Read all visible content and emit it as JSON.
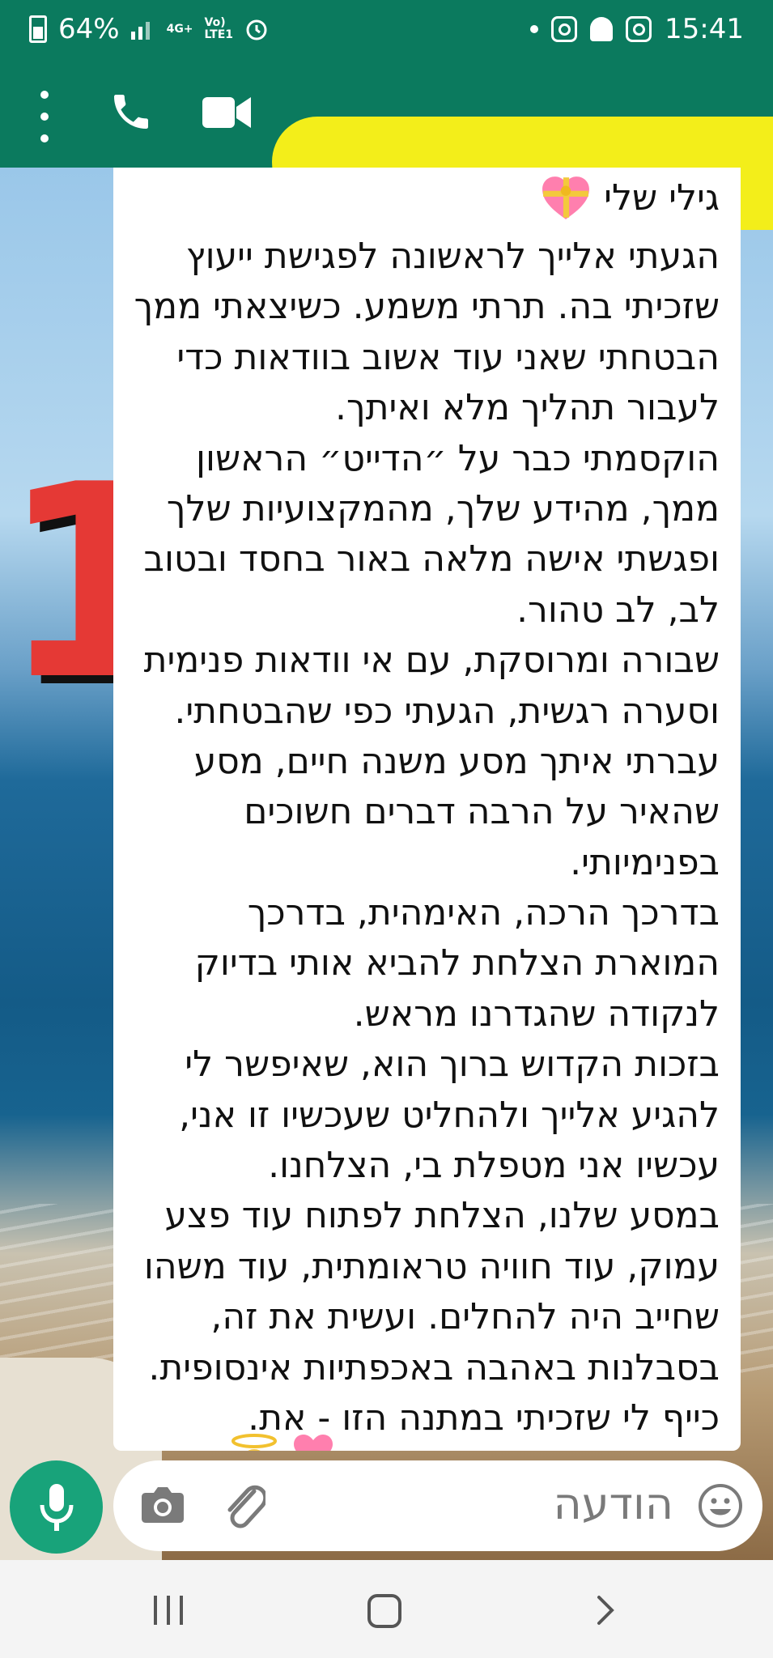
{
  "status": {
    "battery": "64%",
    "network_tag_top": "4G+",
    "network_tag_right_top": "Vo)",
    "network_tag_right_bottom": "LTE1",
    "time": "15:41"
  },
  "overlay": {
    "big_number": "1"
  },
  "message": {
    "title": "גילי שלי",
    "lines": [
      "הגעתי אלייך לראשונה לפגישת ייעוץ",
      "שזכיתי בה. תרתי משמע. כשיצאתי ממך",
      "הבטחתי שאני עוד אשוב בוודאות כדי",
      "לעבור תהליך מלא ואיתך.",
      "הוקסמתי כבר על ״הדייט״ הראשון",
      "ממך, מהידע שלך, מהמקצועיות שלך",
      "ופגשתי  אישה מלאה באור בחסד ובטוב",
      "לב, לב טהור.",
      "שבורה ומרוסקת, עם אי וודאות פנימית",
      "וסערה רגשית, הגעתי כפי שהבטחתי.",
      "עברתי איתך מסע משנה חיים, מסע",
      "שהאיר על הרבה דברים חשוכים",
      "בפנימיותי.",
      "בדרכך הרכה, האימהית, בדרכך",
      "המוארת הצלחת להביא אותי בדיוק",
      "לנקודה שהגדרנו מראש.",
      "בזכות הקדוש ברוך הוא, שאיפשר לי",
      "להגיע אלייך ולהחליט שעכשיו זו אני,",
      "עכשיו אני מטפלת בי, הצלחנו.",
      "במסע שלנו, הצלחת לפתוח עוד פצע",
      "עמוק, עוד חוויה טראומתית, עוד משהו",
      "שחייב היה להחלים. ועשית את זה,",
      "בסבלנות באהבה באכפתיות אינסופית.",
      "כייף לי שזכיתי במתנה הזו - את."
    ]
  },
  "composer": {
    "placeholder": "הודעה"
  },
  "icons": {
    "header": [
      "menu-dots-icon",
      "phone-icon",
      "video-call-icon"
    ],
    "composer": [
      "microphone-icon",
      "camera-icon",
      "attach-icon",
      "emoji-icon"
    ]
  },
  "colors": {
    "header_green": "#0b7a5e",
    "mic_green": "#18a37a",
    "redaction_yellow": "#f3ee1a",
    "number_red": "#e53935"
  }
}
